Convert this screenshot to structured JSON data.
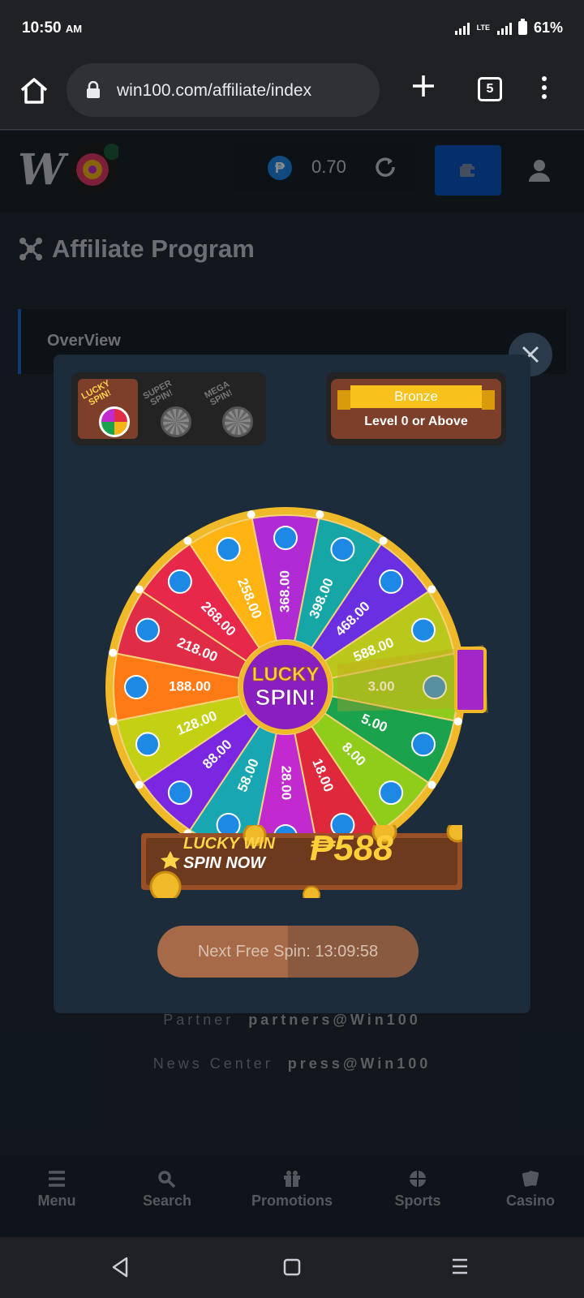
{
  "status_bar": {
    "time": "10:50",
    "ampm": "AM",
    "network": "LTE",
    "battery": "61%"
  },
  "browser": {
    "url": "win100.com/affiliate/index",
    "tab_count": "5"
  },
  "site": {
    "logo": "W",
    "currency_symbol": "₱",
    "balance": "0.70",
    "page_title": "Affiliate Program",
    "overview_label": "OverView",
    "footer": [
      {
        "label": "Partner",
        "value": "partners@Win100"
      },
      {
        "label": "News Center",
        "value": "press@Win100"
      }
    ],
    "bottom_nav": [
      "Menu",
      "Search",
      "Promotions",
      "Sports",
      "Casino"
    ]
  },
  "modal": {
    "spin_types": [
      {
        "label_1": "LUCKY",
        "label_2": "SPIN!",
        "active": true
      },
      {
        "label_1": "SUPER",
        "label_2": "SPIN!",
        "active": false
      },
      {
        "label_1": "MEGA",
        "label_2": "SPIN!",
        "active": false
      }
    ],
    "tier_name": "Bronze",
    "tier_requirement": "Level 0 or Above",
    "wheel_center_1": "LUCKY",
    "wheel_center_2": "SPIN!",
    "wheel_segments": [
      "368.00",
      "398.00",
      "468.00",
      "588.00",
      "3.00",
      "5.00",
      "8.00",
      "18.00",
      "28.00",
      "58.00",
      "88.00",
      "128.00",
      "188.00",
      "218.00",
      "268.00",
      "258.00"
    ],
    "banner_line_1": "LUCKY WIN",
    "banner_line_2": "SPIN NOW",
    "banner_amount": "₱588",
    "next_spin": "Next Free Spin: 13:09:58"
  },
  "colors": {
    "wheel_segments": [
      "#b02bd3",
      "#16a6a6",
      "#6a2fe0",
      "#b9c81a",
      "#8fca1c",
      "#1aa24d",
      "#8fcd1a",
      "#e0283d",
      "#c22ad0",
      "#18a7b2",
      "#7b26e0",
      "#c3d014",
      "#ff7a14",
      "#e12c48",
      "#e8284a",
      "#ffb414"
    ],
    "modal_bg": "#1d2c3a",
    "wallet_button": "#0a56c2"
  }
}
